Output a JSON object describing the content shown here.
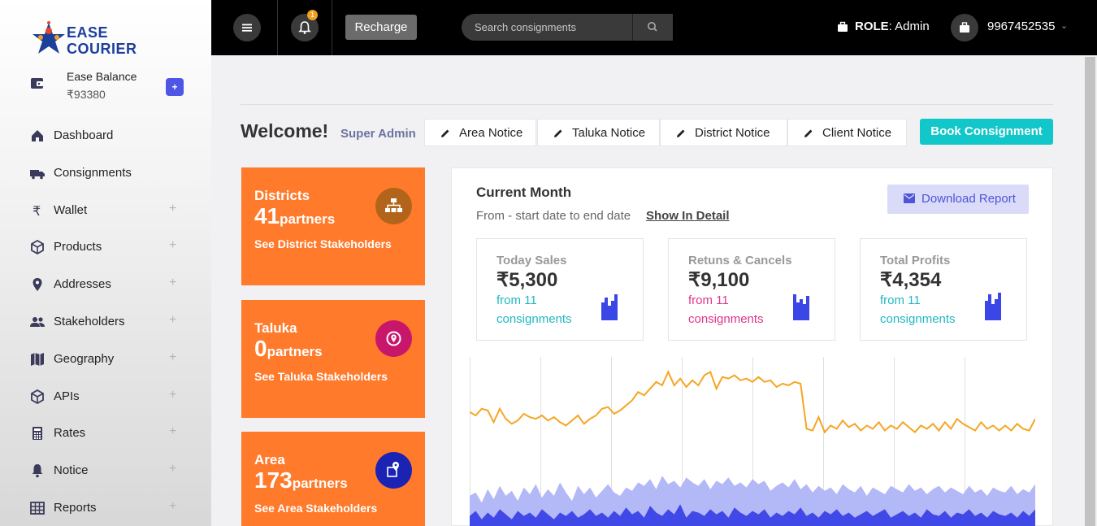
{
  "brand": {
    "line1": "EASE",
    "line2": "COURIER"
  },
  "balance": {
    "label": "Ease Balance",
    "value": "₹93380",
    "add": "+"
  },
  "nav": [
    {
      "label": "Dashboard",
      "icon": "home-icon",
      "expand": ""
    },
    {
      "label": "Consignments",
      "icon": "truck-icon",
      "expand": ""
    },
    {
      "label": "Wallet",
      "icon": "rupee-icon",
      "expand": "+"
    },
    {
      "label": "Products",
      "icon": "box-icon",
      "expand": "+"
    },
    {
      "label": "Addresses",
      "icon": "location-pin-icon",
      "expand": "+"
    },
    {
      "label": "Stakeholders",
      "icon": "people-icon",
      "expand": "+"
    },
    {
      "label": "Geography",
      "icon": "map-icon",
      "expand": "+"
    },
    {
      "label": "APIs",
      "icon": "cube-icon",
      "expand": "+"
    },
    {
      "label": "Rates",
      "icon": "calculator-icon",
      "expand": "+"
    },
    {
      "label": "Notice",
      "icon": "bell-icon",
      "expand": "+"
    },
    {
      "label": "Reports",
      "icon": "table-icon",
      "expand": "+"
    }
  ],
  "topbar": {
    "notif_count": "1",
    "recharge": "Recharge",
    "search_placeholder": "Search consignments",
    "role_label": "ROLE",
    "role_value": ": Admin",
    "phone": "9967452535"
  },
  "main": {
    "welcome": "Welcome!",
    "role": "Super Admin",
    "notices": [
      "Area Notice",
      "Taluka Notice",
      "District Notice",
      "Client Notice"
    ],
    "book": "Book Consignment"
  },
  "stats": [
    {
      "title": "Districts",
      "count": "41",
      "unit": "partners",
      "link": "See District Stakeholders",
      "color": "#b2651a",
      "icon": "hierarchy-icon"
    },
    {
      "title": "Taluka",
      "count": "0",
      "unit": "partners",
      "link": "See Taluka Stakeholders",
      "color": "#c8176b",
      "icon": "location-circle-icon"
    },
    {
      "title": "Area",
      "count": "173",
      "unit": "partners",
      "link": "See Area Stakeholders",
      "color": "#1b23b5",
      "icon": "map-pin-icon"
    }
  ],
  "panel": {
    "title": "Current Month",
    "range": "From - start date to end date",
    "detail": "Show In Detail",
    "download": "Download Report",
    "metrics": [
      {
        "title": "Today Sales",
        "value": "₹5,300",
        "sub": "from 11 consignments",
        "sub_color": "#20b8c0"
      },
      {
        "title": "Retuns & Cancels",
        "value": "₹9,100",
        "sub": "from 11 consignments",
        "sub_color": "#e0368a"
      },
      {
        "title": "Total Profits",
        "value": "₹4,354",
        "sub": "from 11 consignments",
        "sub_color": "#20b8c0"
      }
    ]
  },
  "colors": {
    "accent": "#11c7c9",
    "orange": "#ff7a2b",
    "line": "#f5a623",
    "area_light": "#b3b8f7",
    "area_dark": "#4048e8"
  },
  "chart_data": {
    "type": "area",
    "series": [
      {
        "values": [
          68,
          66,
          70,
          69,
          62,
          70,
          64,
          61,
          63,
          67,
          65,
          64,
          66,
          63,
          65,
          62,
          60,
          63,
          66,
          61,
          64,
          66,
          70,
          71,
          67,
          69,
          72,
          75,
          80,
          78,
          82,
          86,
          84,
          92,
          84,
          88,
          83,
          87,
          84,
          90,
          92,
          82,
          89,
          88,
          90,
          87,
          88,
          86,
          89,
          86,
          87,
          83,
          85,
          84,
          86,
          85,
          58,
          57,
          65,
          56,
          60,
          58,
          63,
          59,
          61,
          57,
          60,
          58,
          62,
          57,
          60,
          58,
          62,
          59,
          56,
          60,
          58,
          61,
          57,
          62,
          58,
          64,
          61,
          59,
          57,
          62,
          58,
          60,
          57,
          60,
          57,
          61,
          58,
          57,
          64
        ]
      },
      {
        "values": [
          18,
          20,
          14,
          22,
          16,
          24,
          18,
          21,
          15,
          23,
          19,
          25,
          17,
          22,
          18,
          26,
          20,
          15,
          24,
          19,
          23,
          17,
          21,
          25,
          20,
          18,
          23,
          21,
          26,
          24,
          28,
          22,
          30,
          25,
          27,
          23,
          29,
          26,
          24,
          28,
          22,
          27,
          25,
          29,
          24,
          26,
          23,
          28,
          25,
          27,
          21,
          24,
          26,
          23,
          28,
          22,
          25,
          20,
          24,
          21,
          23,
          19,
          25,
          22,
          20,
          24,
          18,
          23,
          21,
          19,
          24,
          22,
          20,
          25,
          21,
          23,
          19,
          22,
          24,
          20,
          23,
          21,
          19,
          24,
          20,
          22,
          18,
          23,
          21,
          20,
          24,
          19,
          22,
          20,
          25
        ]
      },
      {
        "values": [
          6,
          9,
          4,
          8,
          5,
          10,
          7,
          4,
          9,
          6,
          8,
          5,
          10,
          7,
          4,
          8,
          6,
          9,
          5,
          7,
          10,
          6,
          8,
          5,
          9,
          6,
          11,
          7,
          9,
          5,
          12,
          8,
          6,
          10,
          7,
          13,
          5,
          9,
          8,
          6,
          10,
          7,
          9,
          5,
          11,
          8,
          6,
          9,
          7,
          10,
          5,
          8,
          6,
          9,
          7,
          11,
          6,
          8,
          5,
          9,
          7,
          10,
          6,
          8,
          5,
          7,
          9,
          6,
          8,
          10,
          5,
          7,
          9,
          6,
          8,
          5,
          10,
          7,
          6,
          9,
          5,
          8,
          7,
          10,
          6,
          8,
          5,
          9,
          7,
          6,
          8,
          5,
          9,
          6,
          10
        ]
      }
    ]
  }
}
